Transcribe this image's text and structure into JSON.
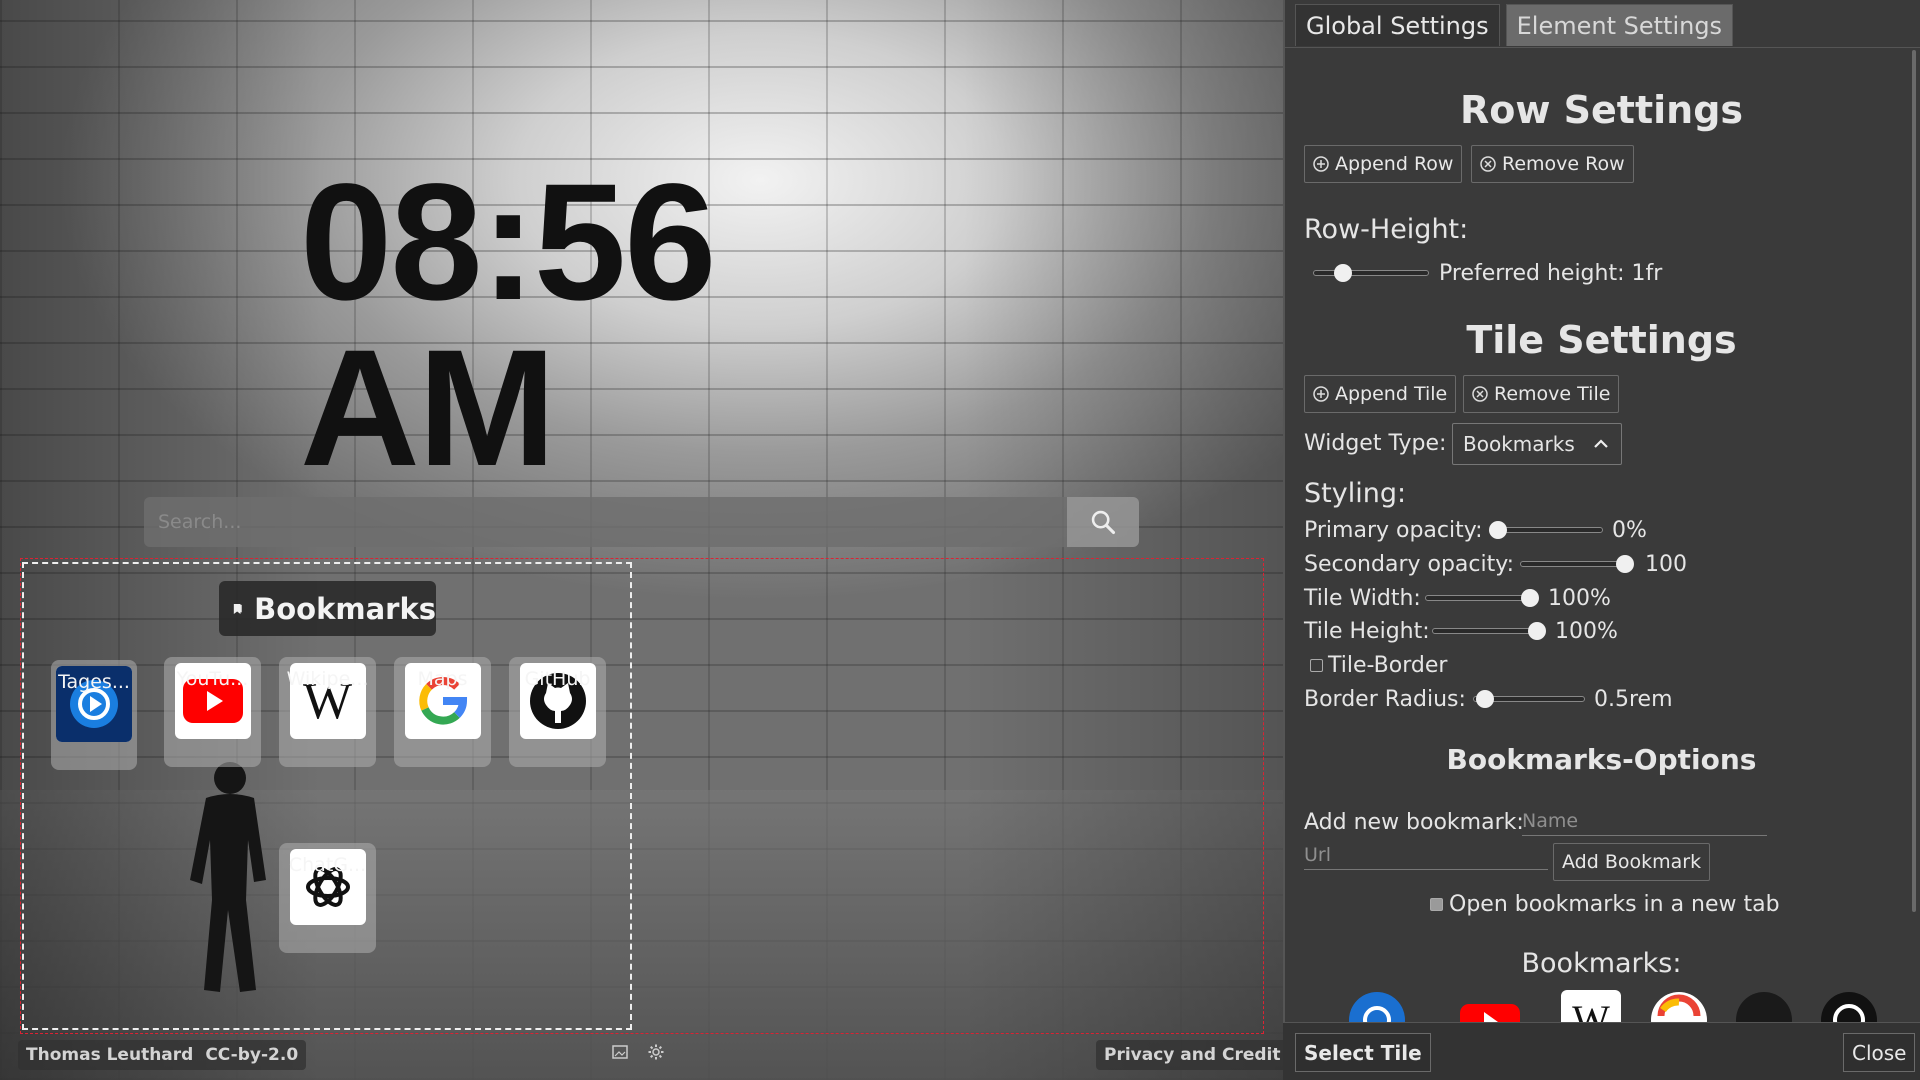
{
  "clock": {
    "time": "08:56 AM"
  },
  "search": {
    "placeholder": "Search..."
  },
  "bookmarks_widget": {
    "title": "Bookmarks",
    "items": [
      {
        "label": "Tages...",
        "icon": "tagesschau-icon"
      },
      {
        "label": "YouTu...",
        "icon": "youtube-icon"
      },
      {
        "label": "Wikipe...",
        "icon": "wikipedia-icon"
      },
      {
        "label": "Maps",
        "icon": "google-icon"
      },
      {
        "label": "GitHub",
        "icon": "github-icon"
      },
      {
        "label": "ChatG...",
        "icon": "chatgpt-icon"
      }
    ]
  },
  "footer": {
    "author": "Thomas Leuthard",
    "license": "CC-by-2.0",
    "privacy": "Privacy and Credit"
  },
  "panel": {
    "tabs": [
      {
        "label": "Global Settings"
      },
      {
        "label": "Element Settings",
        "active": true
      }
    ],
    "row_settings": {
      "title": "Row Settings",
      "append": "Append Row",
      "remove": "Remove Row",
      "height_label": "Row-Height:",
      "height_value": "Preferred height: 1fr",
      "height_slider_fraction": 0.25
    },
    "tile_settings": {
      "title": "Tile Settings",
      "append": "Append Tile",
      "remove": "Remove Tile",
      "widget_type_label": "Widget Type:",
      "widget_type_value": "Bookmarks"
    },
    "styling": {
      "title": "Styling:",
      "primary_opacity": {
        "label": "Primary opacity:",
        "value": "0%",
        "fraction": 0.0
      },
      "secondary_opacity": {
        "label": "Secondary opacity:",
        "value": "100",
        "fraction": 1.0
      },
      "tile_width": {
        "label": "Tile Width:",
        "value": "100%",
        "fraction": 1.0
      },
      "tile_height": {
        "label": "Tile Height:",
        "value": "100%",
        "fraction": 1.0
      },
      "tile_border": {
        "label": "Tile-Border",
        "checked": false
      },
      "border_radius": {
        "label": "Border Radius:",
        "value": "0.5rem",
        "fraction": 0.1
      }
    },
    "bookmarks_options": {
      "title": "Bookmarks-Options",
      "add_label": "Add new bookmark:",
      "name_placeholder": "Name",
      "url_placeholder": "Url",
      "add_button": "Add Bookmark",
      "new_tab_label": "Open bookmarks in a new tab",
      "new_tab_checked": true,
      "list_title": "Bookmarks:"
    },
    "bottom": {
      "select_tile": "Select Tile",
      "close": "Close"
    }
  },
  "colors": {
    "panel_bg": "#3a3a3a",
    "grid_outline": "#dd2233",
    "youtube_red": "#ff0000"
  }
}
